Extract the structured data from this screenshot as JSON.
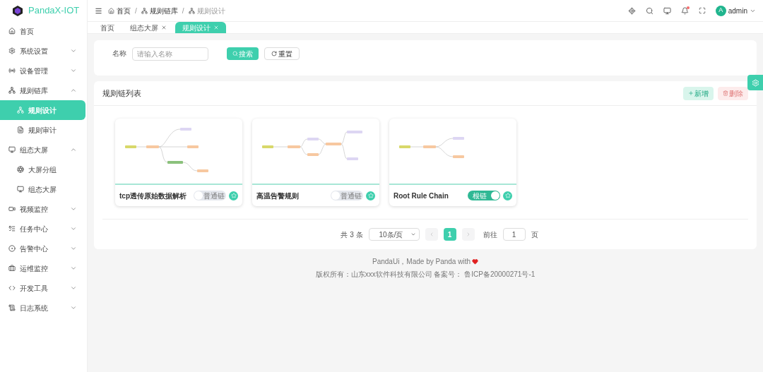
{
  "app": {
    "name": "PandaX-IOT"
  },
  "sidebar": {
    "items": [
      {
        "label": "首页",
        "kind": "link",
        "selected": false
      },
      {
        "label": "系统设置",
        "kind": "group",
        "expanded": false,
        "selected": false
      },
      {
        "label": "设备管理",
        "kind": "group",
        "expanded": false,
        "selected": false
      },
      {
        "label": "规则链库",
        "kind": "group",
        "expanded": true,
        "selected": false,
        "children": [
          {
            "label": "规则设计",
            "selected": true
          },
          {
            "label": "规则审计",
            "selected": false
          }
        ]
      },
      {
        "label": "组态大屏",
        "kind": "group",
        "expanded": true,
        "selected": false,
        "children": [
          {
            "label": "大屏分组",
            "selected": false
          },
          {
            "label": "组态大屏",
            "selected": false
          }
        ]
      },
      {
        "label": "视频监控",
        "kind": "group",
        "expanded": false,
        "selected": false
      },
      {
        "label": "任务中心",
        "kind": "group",
        "expanded": false,
        "selected": false
      },
      {
        "label": "告警中心",
        "kind": "group",
        "expanded": false,
        "selected": false
      },
      {
        "label": "运维监控",
        "kind": "group",
        "expanded": false,
        "selected": false
      },
      {
        "label": "开发工具",
        "kind": "group",
        "expanded": false,
        "selected": false
      },
      {
        "label": "日志系统",
        "kind": "group",
        "expanded": false,
        "selected": false
      }
    ]
  },
  "header": {
    "breadcrumbs": [
      "首页",
      "规则链库",
      "规则设计"
    ],
    "separator": "/",
    "has_unread": true,
    "avatar": "A",
    "user": "admin"
  },
  "tabs": [
    {
      "label": "首页",
      "closable": false,
      "selected": false
    },
    {
      "label": "组态大屏",
      "closable": true,
      "selected": false
    },
    {
      "label": "规则设计",
      "closable": true,
      "selected": true
    }
  ],
  "search": {
    "label": "名称",
    "placeholder": "请输入名称",
    "buttons": [
      "搜索",
      "重置"
    ]
  },
  "panel": {
    "title": "规则链列表",
    "actions": [
      {
        "label": "新增",
        "disabled": false
      },
      {
        "label": "删除",
        "disabled": true
      }
    ]
  },
  "cards": [
    {
      "title": "tcp透传原始数据解析",
      "toggle": {
        "label": "普通链",
        "on": false
      }
    },
    {
      "title": "高温告警规则",
      "toggle": {
        "label": "普通链",
        "on": false
      }
    },
    {
      "title": "Root Rule Chain",
      "toggle": {
        "label": "根链",
        "on": true
      }
    }
  ],
  "pagination": {
    "total": "共 3 条",
    "page_size": "10条/页",
    "pages": [
      {
        "label": "1",
        "selected": true
      }
    ],
    "goto_label": "前往",
    "goto_value": "1",
    "page_suffix": "页"
  },
  "footer": {
    "line1": "PandaUi，Made by Panda with",
    "line2": "版权所有：山东xxx软件科技有限公司 备案号： 鲁ICP备20000271号-1"
  }
}
